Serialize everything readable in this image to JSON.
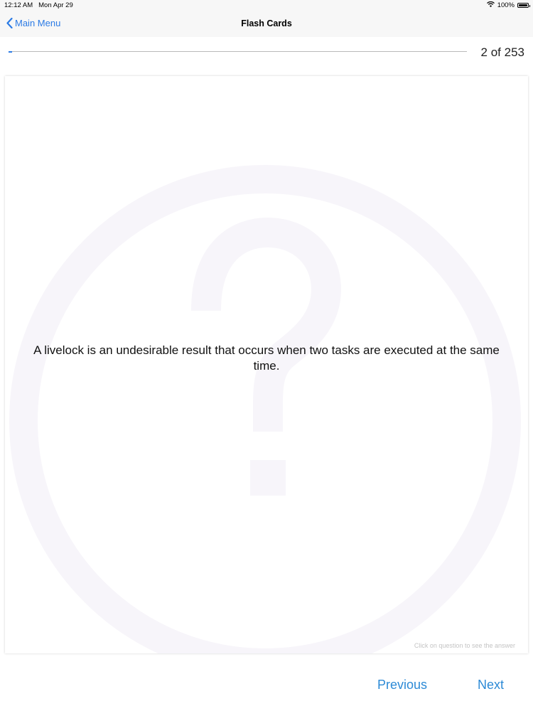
{
  "status_bar": {
    "time": "12:12 AM",
    "date": "Mon Apr 29",
    "battery": "100%",
    "icons": [
      "wifi-icon",
      "battery-icon"
    ]
  },
  "nav": {
    "back_label": "Main Menu",
    "title": "Flash Cards"
  },
  "progress": {
    "current": 2,
    "total": 253,
    "label": "2 of 253",
    "fraction": 0.0079
  },
  "card": {
    "question": "A livelock is an undesirable result that occurs when two tasks are executed at the same time.",
    "hint": "Click on question to see the answer",
    "watermark_icon": "question-mark-circle-icon"
  },
  "footer": {
    "previous_label": "Previous",
    "next_label": "Next"
  },
  "colors": {
    "accent": "#2c7be5",
    "button_text": "#2c8ad6",
    "watermark": "#f7f5fa"
  }
}
